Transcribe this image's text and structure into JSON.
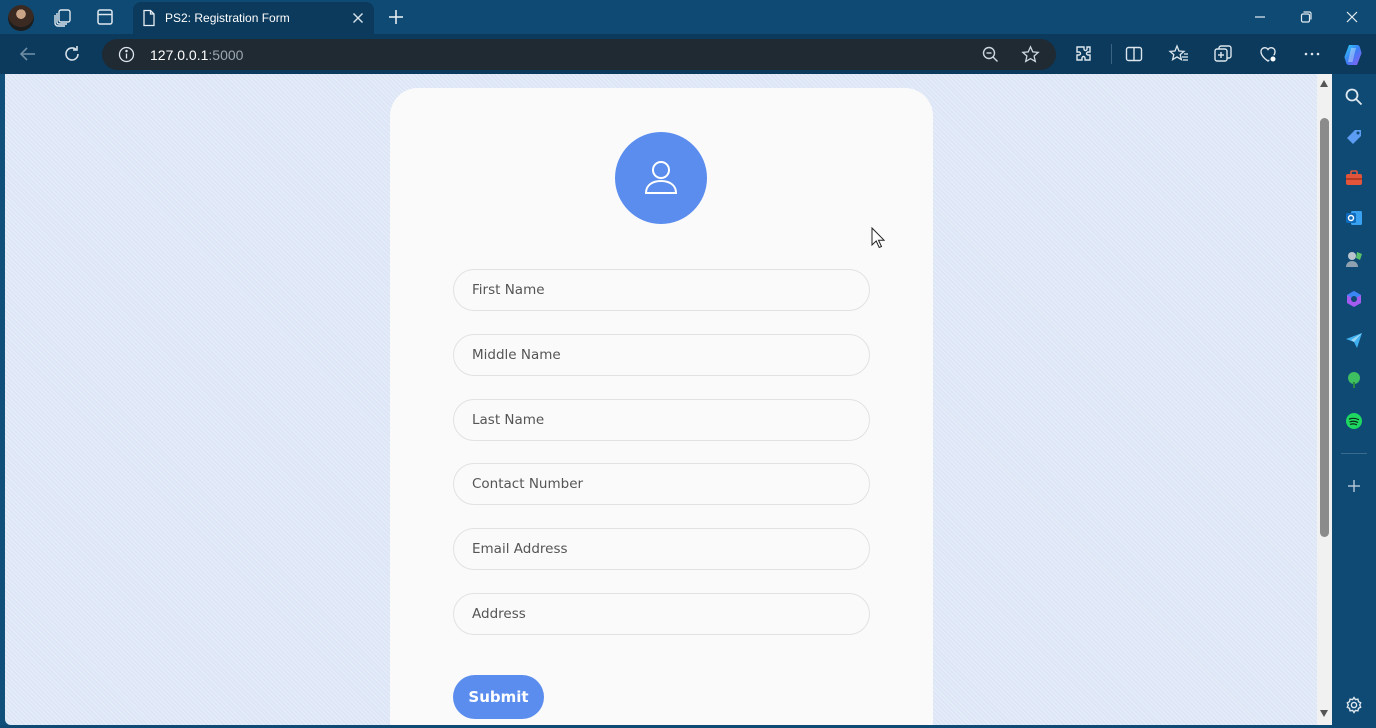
{
  "browser": {
    "tab": {
      "title": "PS2: Registration Form"
    },
    "url": {
      "host": "127.0.0.1",
      "port": ":5000"
    }
  },
  "form": {
    "fields": [
      {
        "placeholder": "First Name",
        "value": ""
      },
      {
        "placeholder": "Middle Name",
        "value": ""
      },
      {
        "placeholder": "Last Name",
        "value": ""
      },
      {
        "placeholder": "Contact Number",
        "value": ""
      },
      {
        "placeholder": "Email Address",
        "value": ""
      },
      {
        "placeholder": "Address",
        "value": ""
      }
    ],
    "submit_label": "Submit",
    "avatar_icon": "user-icon"
  },
  "colors": {
    "accent": "#5b8def",
    "window_frame": "#0e4a73",
    "page_background": "#dce6f6",
    "card_background": "#fafafa"
  },
  "icons": {
    "titlebar": [
      "profile-avatar",
      "workspaces-icon",
      "vertical-tabs-icon",
      "page-icon",
      "close-icon",
      "plus-icon",
      "minimize-icon",
      "restore-icon",
      "close-window-icon"
    ],
    "navbar": [
      "back-icon",
      "refresh-icon",
      "info-icon",
      "zoom-out-icon",
      "favorite-star-icon",
      "extensions-icon",
      "split-screen-icon",
      "favorites-icon",
      "collections-icon",
      "browser-essentials-icon",
      "more-icon",
      "copilot-icon"
    ],
    "sidebar": [
      "search-icon",
      "shopping-tag-icon",
      "tools-icon",
      "outlook-icon",
      "games-icon",
      "m365-icon",
      "drop-icon",
      "tree-icon",
      "spotify-icon",
      "add-icon",
      "settings-icon"
    ]
  }
}
